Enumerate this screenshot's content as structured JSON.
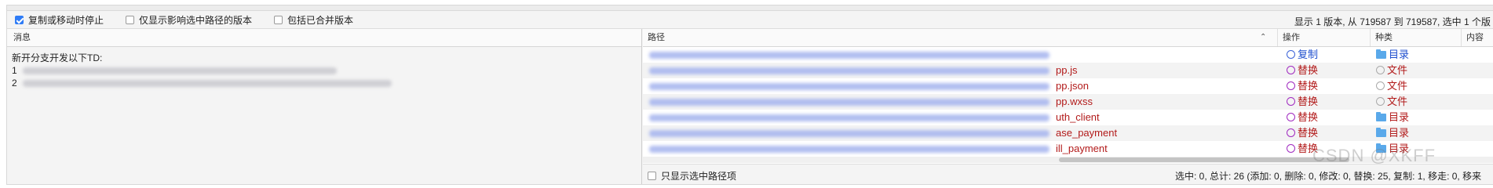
{
  "toolbar": {
    "stop_on_copy": {
      "label": "复制或移动时停止",
      "checked": true
    },
    "only_affect_selected": {
      "label": "仅显示影响选中路径的版本",
      "checked": false
    },
    "include_merged": {
      "label": "包括已合并版本",
      "checked": false
    },
    "revision_info": "显示 1 版本, 从 719587 到 719587, 选中 1 个版"
  },
  "message_pane": {
    "header": "消息",
    "line1": "新开分支开发以下TD:",
    "item1_num": "1",
    "item2_num": "2"
  },
  "paths_pane": {
    "headers": {
      "path": "路径",
      "action": "操作",
      "kind": "种类",
      "content": "内容"
    },
    "rows": [
      {
        "tail": "",
        "action": "复制",
        "action_type": "copy",
        "kind": "目录",
        "kind_type": "folder"
      },
      {
        "tail": "pp.js",
        "action": "替换",
        "action_type": "replace",
        "kind": "文件",
        "kind_type": "file"
      },
      {
        "tail": "pp.json",
        "action": "替换",
        "action_type": "replace",
        "kind": "文件",
        "kind_type": "file"
      },
      {
        "tail": "pp.wxss",
        "action": "替换",
        "action_type": "replace",
        "kind": "文件",
        "kind_type": "file"
      },
      {
        "tail": "uth_client",
        "action": "替换",
        "action_type": "replace",
        "kind": "目录",
        "kind_type": "folder"
      },
      {
        "tail": "ase_payment",
        "action": "替换",
        "action_type": "replace",
        "kind": "目录",
        "kind_type": "folder"
      },
      {
        "tail": "ill_payment",
        "action": "替换",
        "action_type": "replace",
        "kind": "目录",
        "kind_type": "folder"
      }
    ],
    "footer": {
      "only_selected_label": "只显示选中路径项",
      "only_selected_checked": false,
      "stats": "选中: 0, 总计: 26 (添加: 0, 删除: 0, 修改: 0, 替换: 25, 复制: 1, 移走: 0, 移来"
    }
  },
  "watermark": "CSDN @XKFF",
  "colors": {
    "accent": "#2f7cf6",
    "path_red": "#b21a1a",
    "link_blue": "#1f4fcf",
    "replace_purple": "#a02ac0"
  }
}
